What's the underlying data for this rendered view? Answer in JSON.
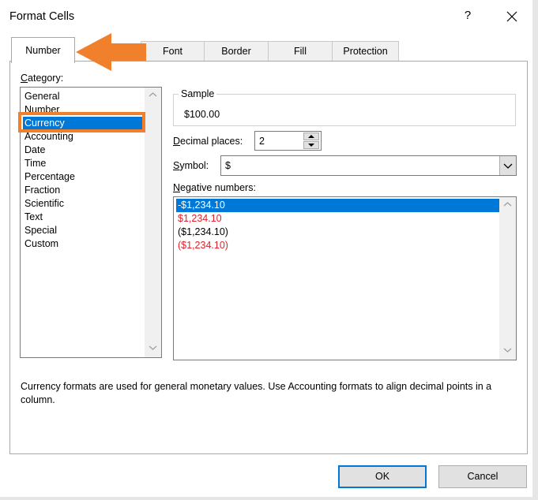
{
  "window": {
    "title": "Format Cells",
    "help_glyph": "?",
    "close_icon": "close-icon"
  },
  "tabs": [
    {
      "label": "Number",
      "active": true
    },
    {
      "label": "Font",
      "active": false
    },
    {
      "label": "Border",
      "active": false
    },
    {
      "label": "Fill",
      "active": false
    },
    {
      "label": "Protection",
      "active": false
    }
  ],
  "category": {
    "label_first": "C",
    "label_rest": "ategory:",
    "items": [
      "General",
      "Number",
      "Currency",
      "Accounting",
      "Date",
      "Time",
      "Percentage",
      "Fraction",
      "Scientific",
      "Text",
      "Special",
      "Custom"
    ],
    "selected": "Currency"
  },
  "sample": {
    "title": "Sample",
    "value": "$100.00"
  },
  "decimal_places": {
    "label_first": "D",
    "label_rest": "ecimal places:",
    "value": "2"
  },
  "symbol": {
    "label_first": "S",
    "label_rest": "ymbol:",
    "value": "$"
  },
  "negative_numbers": {
    "label_first": "N",
    "label_rest": "egative numbers:",
    "items": [
      {
        "text": "-$1,234.10",
        "color": "#000000",
        "selected": true
      },
      {
        "text": "$1,234.10",
        "color": "#e0202a",
        "selected": false
      },
      {
        "text": "($1,234.10)",
        "color": "#000000",
        "selected": false
      },
      {
        "text": "($1,234.10)",
        "color": "#e0202a",
        "selected": false
      }
    ]
  },
  "description": "Currency formats are used for general monetary values.  Use Accounting formats to align decimal points in a column.",
  "buttons": {
    "ok": "OK",
    "cancel": "Cancel"
  },
  "colors": {
    "accent": "#0078d7",
    "highlight": "#f0802b",
    "negative_red": "#e0202a"
  }
}
